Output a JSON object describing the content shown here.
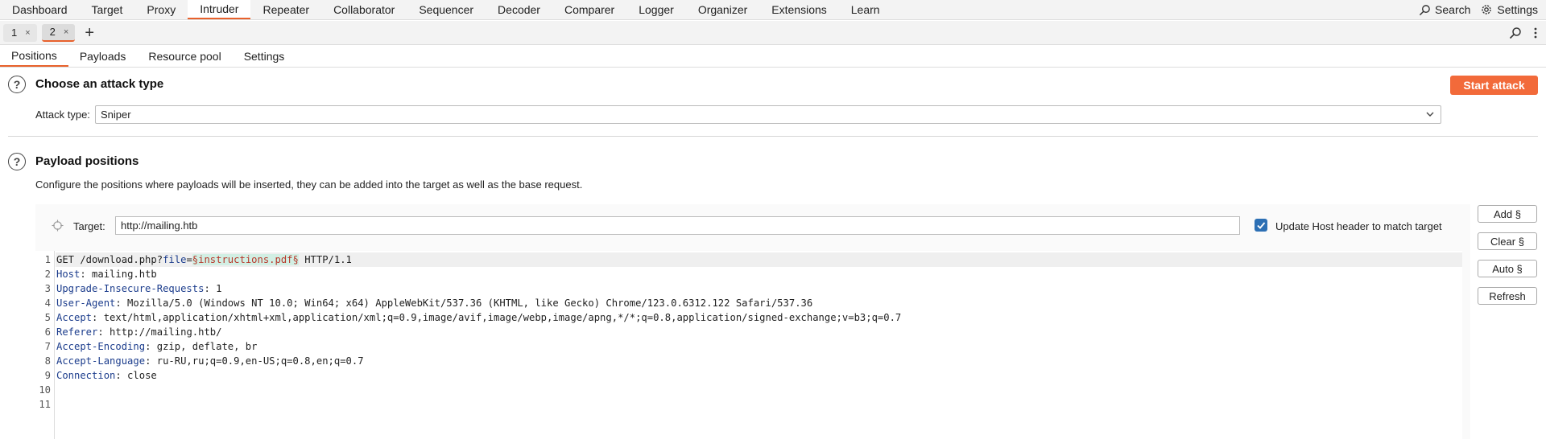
{
  "menu": {
    "items": [
      "Dashboard",
      "Target",
      "Proxy",
      "Intruder",
      "Repeater",
      "Collaborator",
      "Sequencer",
      "Decoder",
      "Comparer",
      "Logger",
      "Organizer",
      "Extensions",
      "Learn"
    ],
    "active": "Intruder",
    "search_label": "Search",
    "settings_label": "Settings"
  },
  "instance_tabs": [
    {
      "label": "1",
      "close": "×"
    },
    {
      "label": "2",
      "close": "×"
    }
  ],
  "instance_add": "+",
  "subtabs": [
    "Positions",
    "Payloads",
    "Resource pool",
    "Settings"
  ],
  "attack": {
    "help": "?",
    "title": "Choose an attack type",
    "start_label": "Start attack",
    "type_label": "Attack type:",
    "type_value": "Sniper"
  },
  "positions": {
    "help": "?",
    "title": "Payload positions",
    "description": "Configure the positions where payloads will be inserted, they can be added into the target as well as the base request.",
    "target_label": "Target:",
    "target_value": "http://mailing.htb",
    "update_host_label": "Update Host header to match target",
    "update_host_checked": true,
    "buttons": {
      "add": "Add §",
      "clear": "Clear §",
      "auto": "Auto §",
      "refresh": "Refresh"
    }
  },
  "request": {
    "line1": {
      "method_path": "GET /download.php?",
      "param": "file",
      "eq": "=",
      "payload": "§instructions.pdf§",
      "proto": " HTTP/1.1"
    },
    "headers": [
      {
        "name": "Host",
        "value": " mailing.htb"
      },
      {
        "name": "Upgrade-Insecure-Requests",
        "value": " 1"
      },
      {
        "name": "User-Agent",
        "value": " Mozilla/5.0 (Windows NT 10.0; Win64; x64) AppleWebKit/537.36 (KHTML, like Gecko) Chrome/123.0.6312.122 Safari/537.36"
      },
      {
        "name": "Accept",
        "value": " text/html,application/xhtml+xml,application/xml;q=0.9,image/avif,image/webp,image/apng,*/*;q=0.8,application/signed-exchange;v=b3;q=0.7"
      },
      {
        "name": "Referer",
        "value": " http://mailing.htb/"
      },
      {
        "name": "Accept-Encoding",
        "value": " gzip, deflate, br"
      },
      {
        "name": "Accept-Language",
        "value": " ru-RU,ru;q=0.9,en-US;q=0.8,en;q=0.7"
      },
      {
        "name": "Connection",
        "value": " close"
      }
    ],
    "line_numbers": [
      "1",
      "2",
      "3",
      "4",
      "5",
      "6",
      "7",
      "8",
      "9",
      "10",
      "11"
    ],
    "colon": ":"
  },
  "icons": {
    "search": "search-icon",
    "settings": "gear-icon",
    "help": "help-circle-icon",
    "crosshair": "crosshair-icon",
    "check": "check-icon",
    "chevron": "chevron-down-icon",
    "more": "kebab-menu-icon"
  },
  "colors": {
    "accent": "#e8612c",
    "start_button": "#f26a3a",
    "checkbox": "#2c6fb4",
    "payload_bg": "#d2efe4",
    "payload_fg": "#b7382b",
    "header_name": "#1b3c8c"
  }
}
